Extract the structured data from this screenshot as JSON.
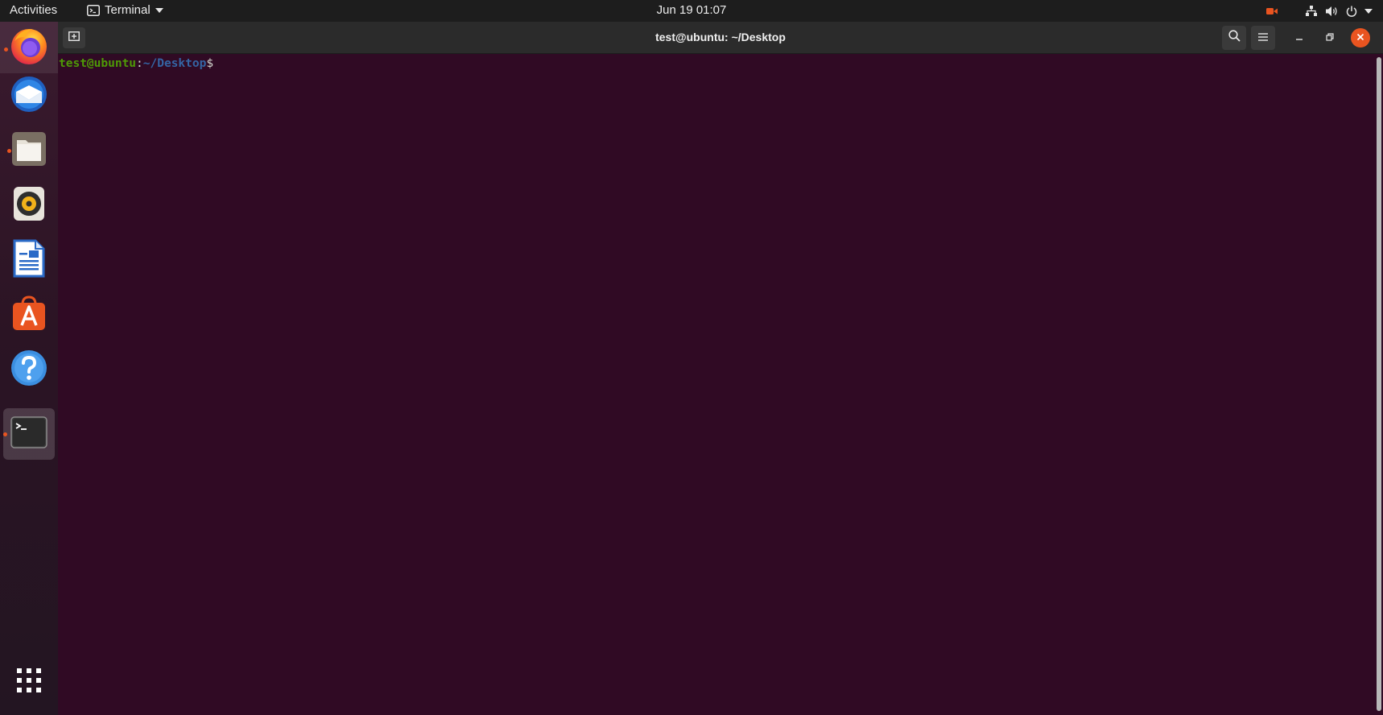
{
  "topbar": {
    "activities_label": "Activities",
    "app_menu_label": "Terminal",
    "clock": "Jun 19  01:07"
  },
  "dock": {
    "items": [
      {
        "name": "Firefox",
        "icon": "firefox-icon",
        "running": true
      },
      {
        "name": "Thunderbird",
        "icon": "thunderbird-icon",
        "running": false
      },
      {
        "name": "Files",
        "icon": "files-icon",
        "running": true
      },
      {
        "name": "Rhythmbox",
        "icon": "rhythmbox-icon",
        "running": false
      },
      {
        "name": "LibreOffice Writer",
        "icon": "writer-icon",
        "running": false
      },
      {
        "name": "Ubuntu Software",
        "icon": "software-icon",
        "running": false
      },
      {
        "name": "Help",
        "icon": "help-icon",
        "running": false
      },
      {
        "name": "Terminal",
        "icon": "terminal-icon",
        "running": true,
        "active": true
      }
    ],
    "apps_grid_icon": "show-applications-icon"
  },
  "window": {
    "title": "test@ubuntu: ~/Desktop",
    "prompt": {
      "user_host": "test@ubuntu",
      "separator": ":",
      "path": "~/Desktop",
      "sign": "$"
    }
  },
  "colors": {
    "terminal_bg": "#300a24",
    "prompt_user": "#4e9a06",
    "prompt_path": "#3465a4",
    "accent": "#e95420"
  }
}
